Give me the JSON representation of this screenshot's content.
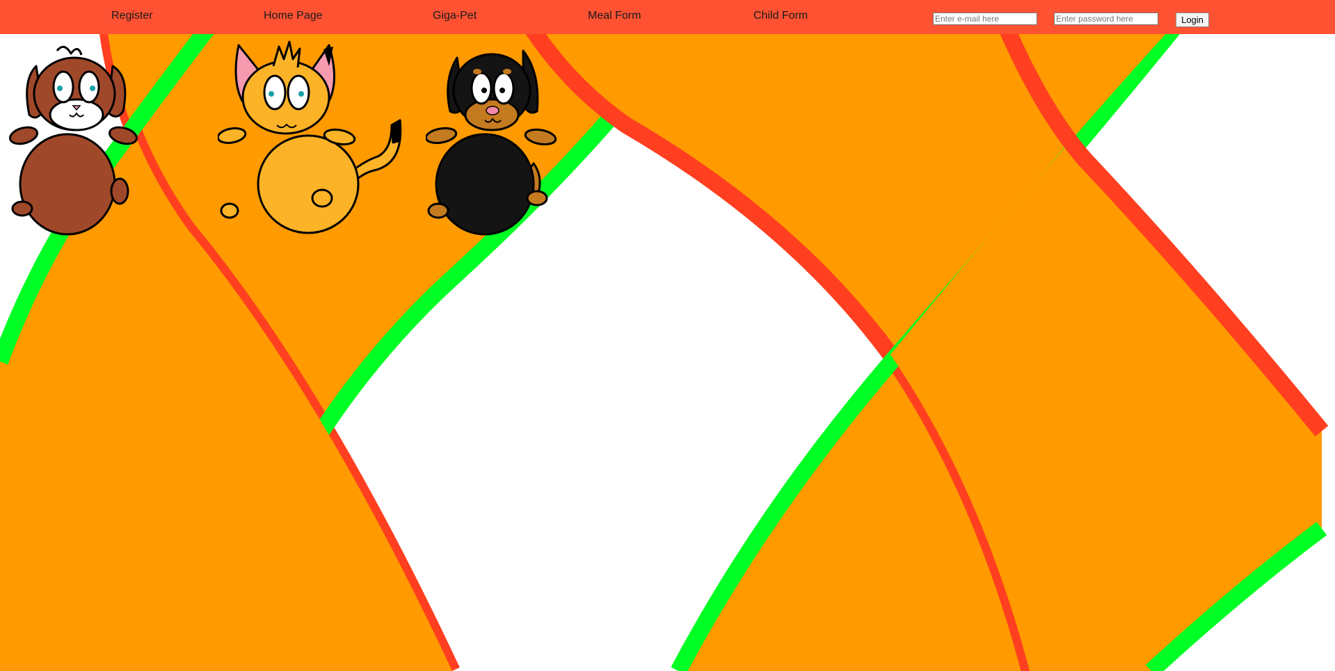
{
  "nav": {
    "items": [
      {
        "label": "Register"
      },
      {
        "label": "Home Page"
      },
      {
        "label": "Giga-Pet"
      },
      {
        "label": "Meal Form"
      },
      {
        "label": "Child Form"
      }
    ]
  },
  "login": {
    "email_placeholder": "Enter e-mail here",
    "password_placeholder": "Enter password here",
    "button_label": "Login"
  },
  "pets": [
    {
      "kind": "brown dog"
    },
    {
      "kind": "orange cat"
    },
    {
      "kind": "black dog"
    }
  ],
  "colors": {
    "navbar": "#ff5233",
    "wave_fill": "#ff9a00",
    "wave_red": "#ff3f1f",
    "wave_green": "#00ff24"
  }
}
